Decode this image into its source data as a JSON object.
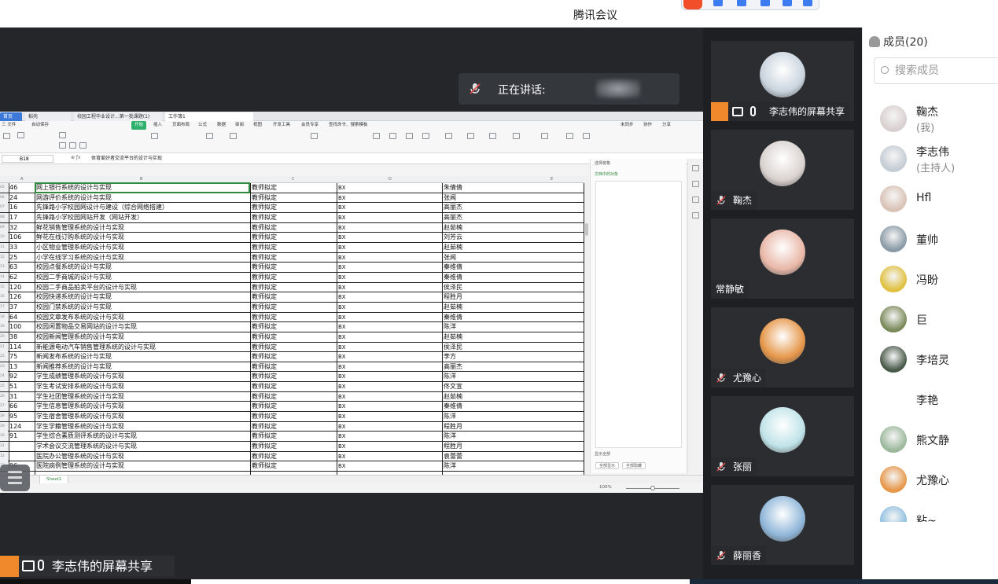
{
  "app": {
    "title": "腾讯会议"
  },
  "speaking": {
    "label": "正在讲话:"
  },
  "spreadsheet": {
    "tabs": [
      "首页",
      "稻壳",
      "校园工程毕业设计...第一批课题(1)",
      "工作簿1"
    ],
    "menu": [
      "三 文件",
      "自动保存",
      "开始",
      "插入",
      "页面布局",
      "公式",
      "数据",
      "审阅",
      "视图",
      "开发工具",
      "会员专享",
      "查找命令、搜索模板",
      "未同步",
      "协作",
      "分享"
    ],
    "name_box": "B18",
    "formula": "体育爱好者交流平台的设计与实现",
    "columns": [
      "A",
      "B",
      "C",
      "D",
      "E"
    ],
    "rows": [
      {
        "rn": "05",
        "a": "46",
        "b": "网上银行系统的设计与实现",
        "c": "教师拟定",
        "d": "BX",
        "e": "朱倩倩"
      },
      {
        "rn": "06",
        "a": "24",
        "b": "网游评价系统的设计与实现",
        "c": "教师拟定",
        "d": "BX",
        "e": "张闻"
      },
      {
        "rn": "07",
        "a": "16",
        "b": "先锋路小学校园网设计与建设（综合网络搭建）",
        "c": "教师拟定",
        "d": "BX",
        "e": "高丽杰"
      },
      {
        "rn": "08",
        "a": "17",
        "b": "先锋路小学校园网站开发（网站开发）",
        "c": "教师拟定",
        "d": "BX",
        "e": "高丽杰"
      },
      {
        "rn": "09",
        "a": "32",
        "b": "鲜花销售管理系统的设计与实现",
        "c": "教师拟定",
        "d": "BX",
        "e": "赵茹楠"
      },
      {
        "rn": "10",
        "a": "106",
        "b": "鲜花在线订购系统的设计与实现",
        "c": "教师拟定",
        "d": "BX",
        "e": "刘芳云"
      },
      {
        "rn": "11",
        "a": "33",
        "b": "小区物业管理系统的设计与实现",
        "c": "教师拟定",
        "d": "BX",
        "e": "赵茹楠"
      },
      {
        "rn": "12",
        "a": "25",
        "b": "小学在线学习系统的设计与实现",
        "c": "教师拟定",
        "d": "BX",
        "e": "张闻"
      },
      {
        "rn": "13",
        "a": "63",
        "b": "校园点餐系统的设计与实现",
        "c": "教师拟定",
        "d": "BX",
        "e": "秦维倩"
      },
      {
        "rn": "14",
        "a": "62",
        "b": "校园二手商城的设计与实现",
        "c": "教师拟定",
        "d": "BX",
        "e": "秦维倩"
      },
      {
        "rn": "15",
        "a": "120",
        "b": "校园二手商品拍卖平台的设计与实现",
        "c": "教师拟定",
        "d": "BX",
        "e": "侯泽民"
      },
      {
        "rn": "16",
        "a": "126",
        "b": "校园快递系统的设计与实现",
        "c": "教师拟定",
        "d": "BX",
        "e": "程胜月"
      },
      {
        "rn": "17",
        "a": "37",
        "b": "校园门禁系统的设计与实现",
        "c": "教师拟定",
        "d": "BX",
        "e": "赵茹楠"
      },
      {
        "rn": "18",
        "a": "64",
        "b": "校园文章发布系统的设计与实现",
        "c": "教师拟定",
        "d": "BX",
        "e": "秦维倩"
      },
      {
        "rn": "19",
        "a": "100",
        "b": "校园闲置物品交易网站的设计与实现",
        "c": "教师拟定",
        "d": "BX",
        "e": "陈洋"
      },
      {
        "rn": "20",
        "a": "38",
        "b": "校园新闻管理系统的设计与实现",
        "c": "教师拟定",
        "d": "BX",
        "e": "赵茹楠"
      },
      {
        "rn": "21",
        "a": "114",
        "b": "新能源电动汽车销售管理系统的设计与实现",
        "c": "教师拟定",
        "d": "BX",
        "e": "侯泽民"
      },
      {
        "rn": "22",
        "a": "75",
        "b": "新闻发布系统的设计与实现",
        "c": "教师拟定",
        "d": "BX",
        "e": "李方"
      },
      {
        "rn": "23",
        "a": "13",
        "b": "新闻推荐系统的设计与实现",
        "c": "教师拟定",
        "d": "BX",
        "e": "高丽杰"
      },
      {
        "rn": "24",
        "a": "92",
        "b": "学生成绩管理系统的设计与实现",
        "c": "教师拟定",
        "d": "BX",
        "e": "陈洋"
      },
      {
        "rn": "25",
        "a": "51",
        "b": "学生考试安排系统的设计与实现",
        "c": "教师拟定",
        "d": "BX",
        "e": "佟文宣"
      },
      {
        "rn": "26",
        "a": "31",
        "b": "学生社团管理系统的设计与实现",
        "c": "教师拟定",
        "d": "BX",
        "e": "赵茹楠"
      },
      {
        "rn": "27",
        "a": "66",
        "b": "学生信息管理系统的设计与实现",
        "c": "教师拟定",
        "d": "BX",
        "e": "秦维倩"
      },
      {
        "rn": "28",
        "a": "95",
        "b": "学生宿舍管理系统的设计与实现",
        "c": "教师拟定",
        "d": "BX",
        "e": "陈洋"
      },
      {
        "rn": "29",
        "a": "124",
        "b": "学生学籍管理系统的设计与实现",
        "c": "教师拟定",
        "d": "BX",
        "e": "程胜月"
      },
      {
        "rn": "30",
        "a": "91",
        "b": "学生综合素质测评系统的设计与实现",
        "c": "教师拟定",
        "d": "BX",
        "e": "陈洋"
      },
      {
        "rn": "31",
        "a": "",
        "b": "学术会议交流管理系统的设计与实现",
        "c": "教师拟定",
        "d": "BX",
        "e": "程胜月"
      },
      {
        "rn": "32",
        "a": "",
        "b": "医院办公管理系统的设计与实现",
        "c": "教师拟定",
        "d": "BX",
        "e": "袁蕾蕾"
      },
      {
        "rn": "33",
        "a": "96",
        "b": "医院病例管理系统的设计与实现",
        "c": "教师拟定",
        "d": "BX",
        "e": "陈洋"
      }
    ],
    "side_pane": {
      "title": "选择窗格",
      "subtitle": "文档中的对象",
      "footer": "显示全部",
      "btn_show": "全部显示",
      "btn_hide": "全部隐藏"
    },
    "sheet_tab": "Sheet1",
    "zoom": "100%"
  },
  "share_label": "李志伟的屏幕共享",
  "video_tiles": [
    {
      "name": "李志伟的屏幕共享",
      "avatar_color": "#c9d4de",
      "muted": false
    },
    {
      "name": "鞠杰",
      "avatar_color": "#d9d2cf",
      "muted": true
    },
    {
      "name": "常静敏",
      "avatar_color": "#e9b8a8",
      "muted": false
    },
    {
      "name": "尤豫心",
      "avatar_color": "#e6974a",
      "muted": true
    },
    {
      "name": "张丽",
      "avatar_color": "#bfe3e8",
      "muted": true
    },
    {
      "name": "薛丽香",
      "avatar_color": "#8fb6d9",
      "muted": true
    }
  ],
  "members": {
    "header": "成员(20)",
    "search_placeholder": "搜索成员",
    "list": [
      {
        "name": "鞠杰",
        "sub": "(我)",
        "color": "#d8d0ce"
      },
      {
        "name": "李志伟",
        "sub": "(主持人)",
        "color": "#c4ccd4"
      },
      {
        "name": "Hfl",
        "sub": "",
        "color": "#d9c2b6"
      },
      {
        "name": "董帅",
        "sub": "",
        "color": "#8a9aa6"
      },
      {
        "name": "冯盼",
        "sub": "",
        "color": "#e0c040"
      },
      {
        "name": "巨",
        "sub": "",
        "color": "#7b8a5a"
      },
      {
        "name": "李培灵",
        "sub": "",
        "color": "#4a5a4a"
      },
      {
        "name": "李艳",
        "sub": "",
        "color": "#ffffff"
      },
      {
        "name": "熊文静",
        "sub": "",
        "color": "#9cb89c"
      },
      {
        "name": "尤豫心",
        "sub": "",
        "color": "#e6974a"
      },
      {
        "name": "粘~",
        "sub": "",
        "color": "#8fc0e0"
      }
    ]
  }
}
